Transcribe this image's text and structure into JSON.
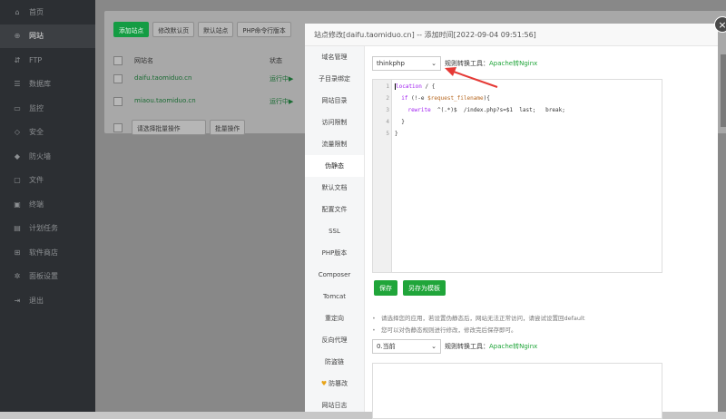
{
  "sidebar": {
    "items": [
      {
        "icon": "home-icon",
        "glyph": "⌂",
        "label": "首页"
      },
      {
        "icon": "globe-icon",
        "glyph": "⊕",
        "label": "网站",
        "active": true
      },
      {
        "icon": "ftp-icon",
        "glyph": "⇵",
        "label": "FTP"
      },
      {
        "icon": "database-icon",
        "glyph": "☰",
        "label": "数据库"
      },
      {
        "icon": "monitor-icon",
        "glyph": "▭",
        "label": "监控"
      },
      {
        "icon": "shield-icon",
        "glyph": "◇",
        "label": "安全"
      },
      {
        "icon": "firewall-icon",
        "glyph": "◆",
        "label": "防火墙"
      },
      {
        "icon": "folder-icon",
        "glyph": "▢",
        "label": "文件"
      },
      {
        "icon": "terminal-icon",
        "glyph": "▣",
        "label": "终端"
      },
      {
        "icon": "calendar-icon",
        "glyph": "▤",
        "label": "计划任务"
      },
      {
        "icon": "grid-icon",
        "glyph": "⊞",
        "label": "软件商店"
      },
      {
        "icon": "gear-icon",
        "glyph": "✲",
        "label": "面板设置"
      },
      {
        "icon": "logout-icon",
        "glyph": "⇥",
        "label": "退出"
      }
    ]
  },
  "toolbar": {
    "add_site": "添加站点",
    "change_default_page": "修改默认页",
    "default_site": "默认站点",
    "php_cli_version": "PHP命令行版本"
  },
  "table": {
    "col_site": "网站名",
    "col_status": "状态",
    "rows": [
      {
        "domain": "daifu.taomiduo.cn",
        "status": "运行中▶"
      },
      {
        "domain": "miaou.taomiduo.cn",
        "status": "运行中▶"
      }
    ],
    "batch_select_placeholder": "请选择批量操作",
    "batch_button": "批量操作"
  },
  "dialog": {
    "title": "站点修改[daifu.taomiduo.cn] -- 添加时间[2022-09-04 09:51:56]",
    "close": "×",
    "nav": [
      "域名管理",
      "子目录绑定",
      "网站目录",
      "访问限制",
      "流量限制",
      "伪静态",
      "默认文档",
      "配置文件",
      "SSL",
      "PHP版本",
      "Composer",
      "Tomcat",
      "重定向",
      "反向代理",
      "防盗链",
      "防篡改",
      "网站日志"
    ],
    "active_nav": "伪静态",
    "rewrite_select": "thinkphp",
    "converter_label": "规则转换工具：",
    "converter_link": "Apache转Nginx",
    "line_numbers": [
      "1",
      "2",
      "3",
      "4",
      "5"
    ],
    "save": "保存",
    "save_as_template": "另存为模板",
    "tips": [
      "请选择您的应用，若设置伪静态后，网站无法正常访问，请尝试设置回default",
      "您可以对伪静态规则进行修改，修改完后保存即可。"
    ],
    "dir_select": "0.当前",
    "colors": {
      "accent": "#20a53a",
      "sidebar_bg": "#2c2f33",
      "arrow": "#e53935"
    }
  }
}
